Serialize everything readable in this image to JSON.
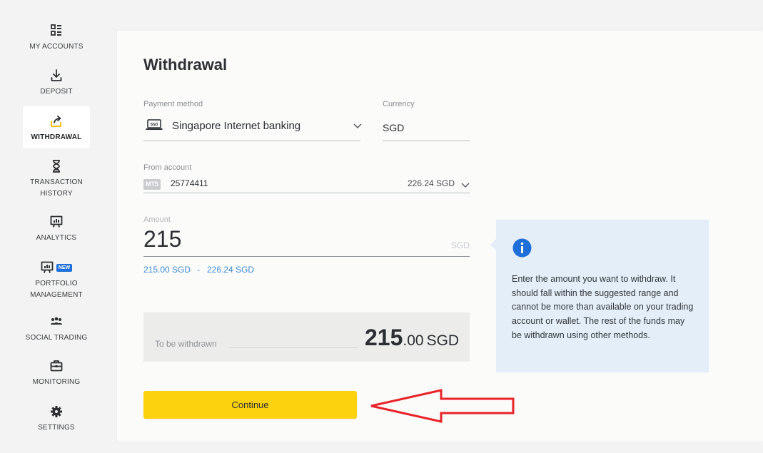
{
  "sidebar": {
    "items": [
      {
        "label": "MY ACCOUNTS",
        "icon": "accounts-grid-icon"
      },
      {
        "label": "DEPOSIT",
        "icon": "deposit-download-icon"
      },
      {
        "label": "WITHDRAWAL",
        "icon": "withdrawal-upload-icon",
        "active": true
      },
      {
        "label": "TRANSACTION HISTORY",
        "icon": "hourglass-icon"
      },
      {
        "label": "ANALYTICS",
        "icon": "analytics-chart-icon"
      },
      {
        "label": "PORTFOLIO MANAGEMENT",
        "icon": "portfolio-chart-icon",
        "badge": "NEW"
      },
      {
        "label": "SOCIAL TRADING",
        "icon": "social-people-icon"
      },
      {
        "label": "MONITORING",
        "icon": "briefcase-icon"
      },
      {
        "label": "SETTINGS",
        "icon": "gear-icon"
      }
    ]
  },
  "main": {
    "title": "Withdrawal",
    "payment_method": {
      "label": "Payment method",
      "value": "Singapore Internet banking",
      "icon_text": "SGD"
    },
    "currency": {
      "label": "Currency",
      "value": "SGD"
    },
    "from_account": {
      "label": "From account",
      "platform": "MT5",
      "number": "25774411",
      "balance": "226.24 SGD"
    },
    "amount": {
      "label": "Amount",
      "value": "215",
      "currency": "SGD",
      "range_min": "215.00 SGD",
      "range_sep": "-",
      "range_max": "226.24 SGD"
    },
    "summary": {
      "label": "To be withdrawn",
      "amount_int": "215",
      "amount_dec": ".00",
      "currency": "SGD"
    },
    "continue_label": "Continue",
    "info": {
      "text": "Enter the amount you want to withdraw. It should fall within the suggested range and cannot be more than available on your trading account or wallet. The rest of the funds may be withdrawn using other methods."
    }
  },
  "colors": {
    "accent_yellow": "#fcd20f",
    "link_blue": "#3d8bd3",
    "info_bg": "#e3eef9",
    "info_icon": "#1e6fd9",
    "annotation_arrow": "#e8232a"
  }
}
